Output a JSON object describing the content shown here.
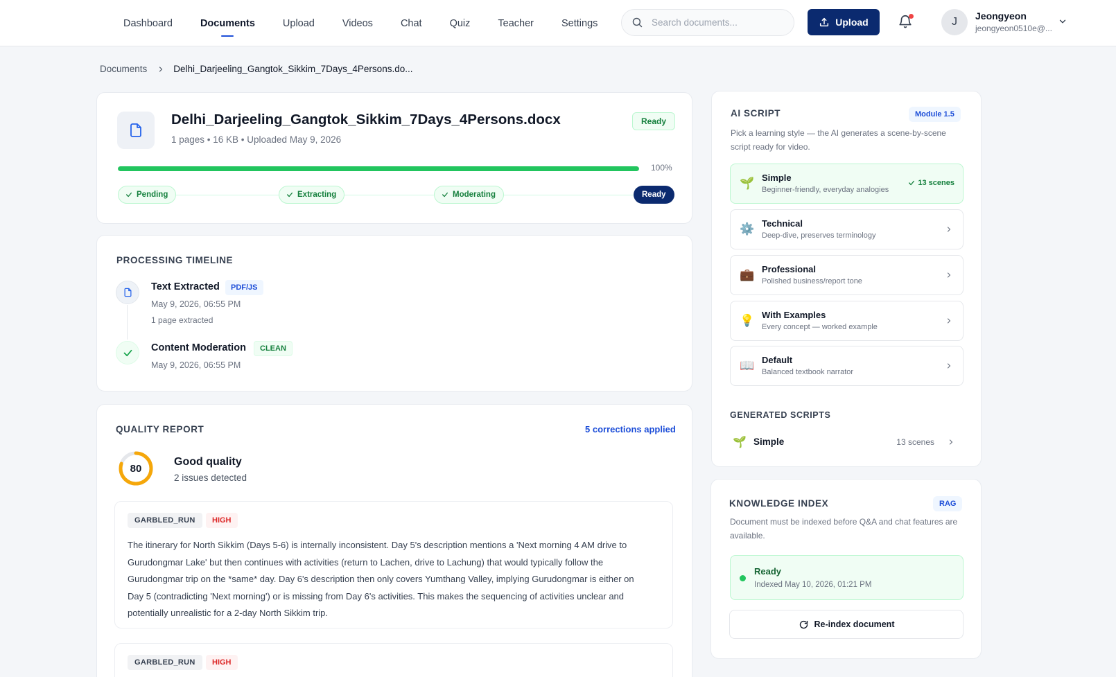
{
  "nav": {
    "items": [
      {
        "label": "Dashboard",
        "active": false
      },
      {
        "label": "Documents",
        "active": true
      },
      {
        "label": "Upload",
        "active": false
      },
      {
        "label": "Videos",
        "active": false
      },
      {
        "label": "Chat",
        "active": false
      },
      {
        "label": "Quiz",
        "active": false
      },
      {
        "label": "Teacher",
        "active": false
      },
      {
        "label": "Settings",
        "active": false
      }
    ],
    "search_placeholder": "Search documents...",
    "upload_label": "Upload",
    "user": {
      "initial": "J",
      "name": "Jeongyeon",
      "email": "jeongyeon0510e@..."
    }
  },
  "breadcrumb": {
    "root": "Documents",
    "current": "Delhi_Darjeeling_Gangtok_Sikkim_7Days_4Persons.do..."
  },
  "document": {
    "title": "Delhi_Darjeeling_Gangtok_Sikkim_7Days_4Persons.docx",
    "meta": "1 pages • 16 KB • Uploaded May 9, 2026",
    "status": "Ready",
    "progress": 100,
    "progress_label": "100%",
    "stages": [
      "Pending",
      "Extracting",
      "Moderating"
    ],
    "final_stage": "Ready"
  },
  "timeline": {
    "title": "PROCESSING TIMELINE",
    "events": [
      {
        "title": "Text Extracted",
        "tag": "PDF/JS",
        "time": "May 9, 2026, 06:55 PM",
        "detail": "1 page extracted"
      },
      {
        "title": "Content Moderation",
        "tag": "CLEAN",
        "time": "May 9, 2026, 06:55 PM"
      }
    ]
  },
  "quality": {
    "title": "QUALITY REPORT",
    "corrections": "5 corrections applied",
    "score": 80,
    "score_label": "80",
    "label": "Good quality",
    "issues_summary": "2 issues detected",
    "issues": [
      {
        "type": "GARBLED_RUN",
        "severity": "HIGH",
        "text": "The itinerary for North Sikkim (Days 5-6) is internally inconsistent. Day 5's description mentions a 'Next morning 4 AM drive to Gurudongmar Lake' but then continues with activities (return to Lachen, drive to Lachung) that would typically follow the Gurudongmar trip on the *same* day. Day 6's description then only covers Yumthang Valley, implying Gurudongmar is either on Day 5 (contradicting 'Next morning') or is missing from Day 6's activities. This makes the sequencing of activities unclear and potentially unrealistic for a 2-day North Sikkim trip."
      },
      {
        "type": "GARBLED_RUN",
        "severity": "HIGH",
        "text": ""
      }
    ]
  },
  "ai_script": {
    "title": "AI SCRIPT",
    "module": "Module 1.5",
    "description": "Pick a learning style — the AI generates a scene-by-scene script ready for video.",
    "styles": [
      {
        "emoji": "🌱",
        "name": "Simple",
        "desc": "Beginner-friendly, everyday analogies",
        "scenes": "13 scenes",
        "selected": true
      },
      {
        "emoji": "⚙️",
        "name": "Technical",
        "desc": "Deep-dive, preserves terminology"
      },
      {
        "emoji": "💼",
        "name": "Professional",
        "desc": "Polished business/report tone"
      },
      {
        "emoji": "💡",
        "name": "With Examples",
        "desc": "Every concept — worked example"
      },
      {
        "emoji": "📖",
        "name": "Default",
        "desc": "Balanced textbook narrator"
      }
    ],
    "generated_title": "GENERATED SCRIPTS",
    "generated": [
      {
        "emoji": "🌱",
        "name": "Simple",
        "count": "13 scenes"
      }
    ]
  },
  "knowledge_index": {
    "title": "KNOWLEDGE INDEX",
    "badge": "RAG",
    "description": "Document must be indexed before Q&A and chat features are available.",
    "status": "Ready",
    "indexed": "Indexed May 10, 2026, 01:21 PM",
    "reindex_label": "Re-index document"
  },
  "colors": {
    "brand": "#0b2a6f",
    "success": "#22c55e",
    "accent": "#1d4ed8",
    "score_ring": "#f5a70a",
    "danger": "#dc2626"
  }
}
